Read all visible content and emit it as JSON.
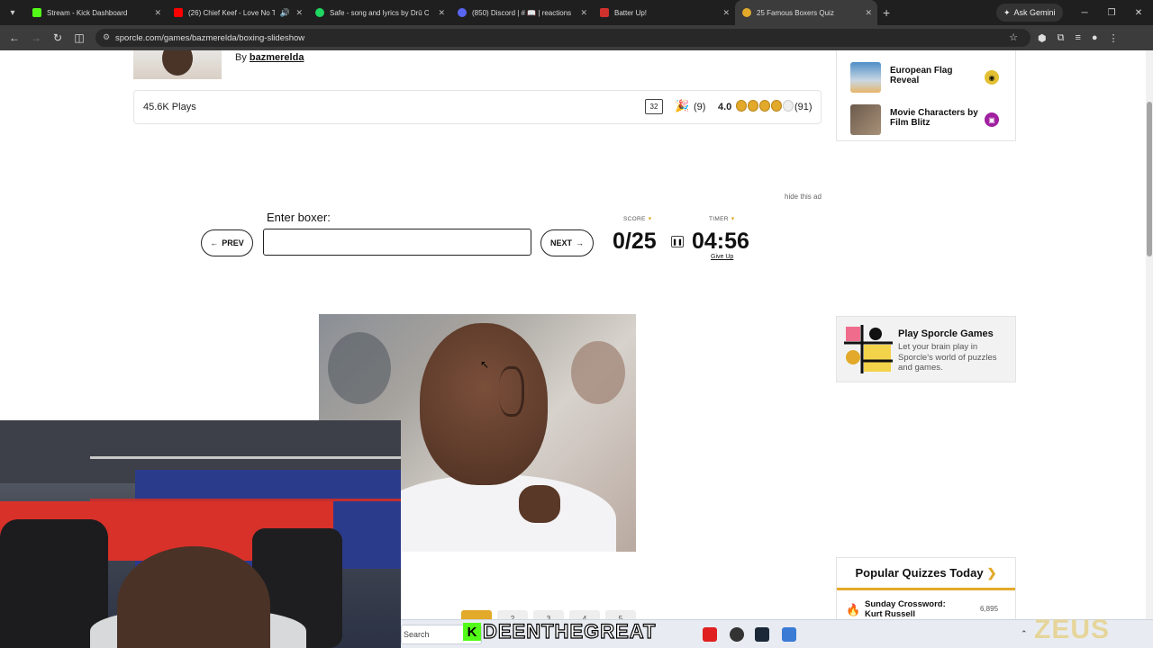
{
  "browser": {
    "tabs": [
      {
        "label": "Stream - Kick Dashboard",
        "color": "#53fc18"
      },
      {
        "label": "(26) Chief Keef - Love No Th",
        "color": "#ff0000"
      },
      {
        "label": "Safe - song and lyrics by Drū Ch",
        "color": "#1ed760"
      },
      {
        "label": "(850) Discord | # 📖 | reactions",
        "color": "#5865f2"
      },
      {
        "label": "Batter Up!",
        "color": "#d0312d"
      },
      {
        "label": "25 Famous Boxers Quiz",
        "color": "#e2a92a"
      }
    ],
    "gemini_label": "Ask Gemini",
    "url": "sporcle.com/games/bazmerelda/boxing-slideshow"
  },
  "quiz": {
    "by_prefix": "By",
    "author": "bazmerelda",
    "plays": "45.6K Plays",
    "comments": "32",
    "celebrations": "(9)",
    "rating": "4.0",
    "rating_stars": 4,
    "rating_count": "(91)",
    "hide_ad": "hide this ad",
    "enter_label": "Enter boxer:",
    "input_value": "",
    "prev_label": "PREV",
    "next_label": "NEXT",
    "score_label": "SCORE",
    "timer_label": "TIMER",
    "score": "0/25",
    "timer": "04:56",
    "give_up": "Give Up"
  },
  "sidebar": {
    "related": [
      {
        "title": "European Flag Reveal",
        "badge_color": "#e2c032"
      },
      {
        "title": "Movie Characters by Film Blitz",
        "badge_color": "#a020a0"
      }
    ],
    "promo": {
      "title": "Play Sporcle Games",
      "text": "Let your brain play in Sporcle's world of puzzles and games."
    },
    "popular": {
      "heading": "Popular Quizzes Today",
      "items": [
        {
          "title": "Sunday Crossword: Kurt Russell",
          "count": "6,895"
        }
      ]
    }
  },
  "pager": [
    "",
    "2",
    "3",
    "4",
    "5"
  ],
  "overlay": {
    "streamer": "DEENTHEGREAT",
    "kick_letter": "K",
    "zeus": "ZEUS",
    "wc_banner": "zeus"
  },
  "taskbar": {
    "search": "Search"
  }
}
